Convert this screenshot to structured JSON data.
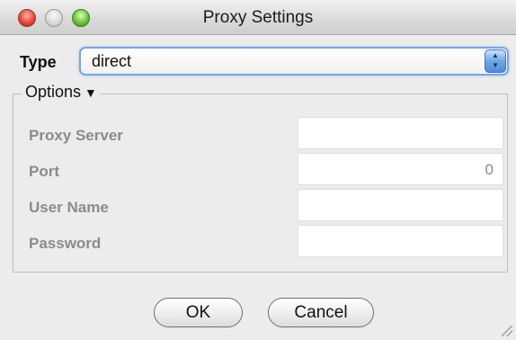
{
  "window": {
    "title": "Proxy Settings"
  },
  "type": {
    "label": "Type",
    "selected": "direct"
  },
  "options": {
    "legend": "Options",
    "fields": [
      {
        "label": "Proxy Server",
        "value": ""
      },
      {
        "label": "Port",
        "value": "0"
      },
      {
        "label": "User Name",
        "value": ""
      },
      {
        "label": "Password",
        "value": ""
      }
    ]
  },
  "buttons": {
    "ok": "OK",
    "cancel": "Cancel"
  },
  "icons": {
    "close": "close-light-icon",
    "minimize": "minimize-light-icon",
    "zoom": "zoom-light-icon",
    "stepper": "up-down-stepper-icon",
    "disclosure": "triangle-down-icon",
    "resize": "resize-grip-icon"
  }
}
